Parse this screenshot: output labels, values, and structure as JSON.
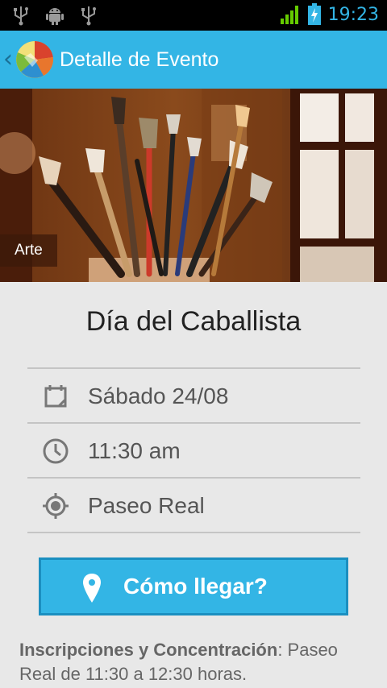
{
  "status_bar": {
    "time": "19:23",
    "left_icons": [
      "usb-icon",
      "android-debug-icon",
      "usb-icon"
    ],
    "right_icons": [
      "signal-icon",
      "battery-charging-icon"
    ]
  },
  "action_bar": {
    "title": "Detalle de Evento",
    "back_icon": "chevron-left-icon",
    "accent": "#33b5e5"
  },
  "hero": {
    "category": "Arte",
    "image": "paintbrushes-in-jar"
  },
  "event": {
    "title": "Día del Caballista",
    "details": [
      {
        "icon": "calendar-icon",
        "text": "Sábado 24/08"
      },
      {
        "icon": "clock-icon",
        "text": "11:30 am"
      },
      {
        "icon": "location-icon",
        "text": "Paseo Real"
      }
    ],
    "directions_button": "Cómo llegar?",
    "description_label": "Inscripciones y Concentración",
    "description_text": ": Paseo Real de 11:30 a 12:30 horas."
  }
}
